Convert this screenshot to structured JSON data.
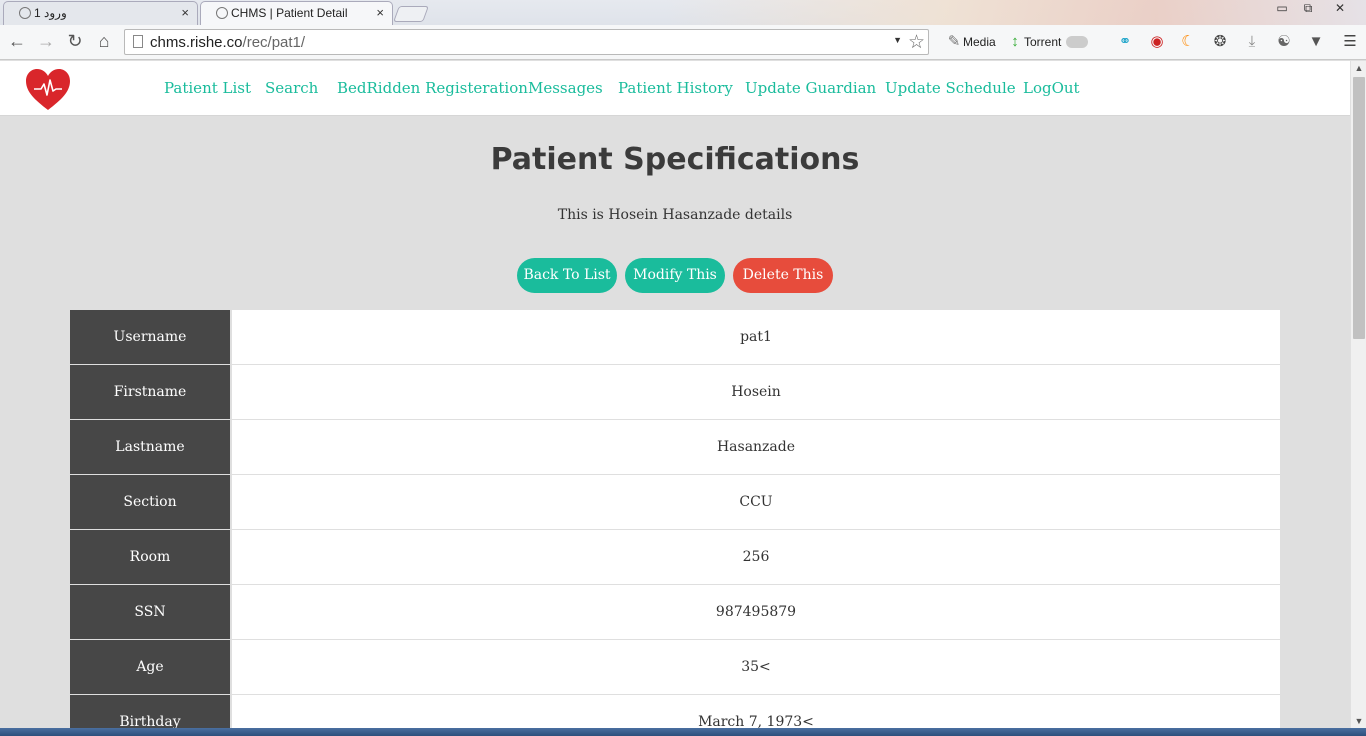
{
  "browser": {
    "tabs": [
      {
        "title": "ورود 1",
        "close": "×"
      },
      {
        "title": "CHMS | Patient Detail",
        "close": "×"
      }
    ],
    "window_controls": {
      "minimize": "▭",
      "restore": "⧉",
      "close": "✕"
    },
    "url_host": "chms.rishe.co",
    "url_path": "/rec/pat1/",
    "extensions": {
      "media": "Media",
      "torrent": "Torrent"
    }
  },
  "nav": {
    "items": [
      "Patient List",
      "Search",
      "BedRidden Registeration",
      "Messages",
      "Patient History",
      "Update Guardian",
      "Update Schedule",
      "LogOut"
    ]
  },
  "page": {
    "title": "Patient Specifications",
    "subtitle": "This is Hosein Hasanzade details",
    "buttons": {
      "back": "Back To List",
      "modify": "Modify This",
      "delete": "Delete This"
    }
  },
  "details": [
    {
      "label": "Username",
      "value": "pat1"
    },
    {
      "label": "Firstname",
      "value": "Hosein"
    },
    {
      "label": "Lastname",
      "value": "Hasanzade"
    },
    {
      "label": "Section",
      "value": "CCU"
    },
    {
      "label": "Room",
      "value": "256"
    },
    {
      "label": "SSN",
      "value": "987495879"
    },
    {
      "label": "Age",
      "value": "35<"
    },
    {
      "label": "Birthday",
      "value": "March 7, 1973<"
    }
  ],
  "colors": {
    "accent": "#1abc9c",
    "danger": "#e74c3c",
    "label_bg": "#474747",
    "page_bg": "#dfdfdf"
  }
}
